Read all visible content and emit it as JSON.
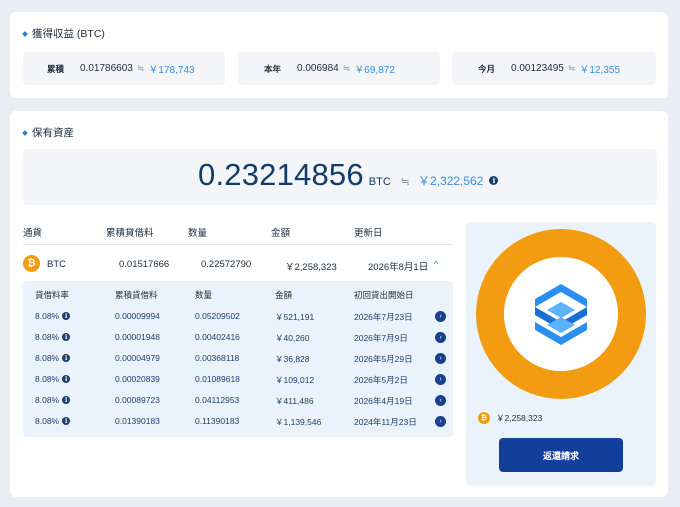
{
  "earnings": {
    "title": "獲得収益 (BTC)",
    "items": [
      {
        "label": "累積",
        "btc": "0.01786603",
        "approx": "≒",
        "yen": "￥178,743"
      },
      {
        "label": "本年",
        "btc": "0.006984",
        "approx": "≒",
        "yen": "￥69,872"
      },
      {
        "label": "今月",
        "btc": "0.00123495",
        "approx": "≒",
        "yen": "￥12,355"
      }
    ]
  },
  "holdings": {
    "title": "保有資産",
    "balance": "0.23214856",
    "unit": "BTC",
    "approx": "≒",
    "yen": "￥2,322,562",
    "headers": [
      "通貨",
      "累積貸借料",
      "数量",
      "金額",
      "更新日"
    ],
    "btc_row": {
      "icon": "bitcoin-icon",
      "currency": "BTC",
      "fee": "0.01517666",
      "qty": "0.22572790",
      "amount": "￥2,258,323",
      "date": "2026年8月1日"
    },
    "sub_headers": [
      "貸借料率",
      "累積貸借料",
      "数量",
      "金額",
      "初回貸出開始日"
    ],
    "sub_rows": [
      {
        "rate": "8.08%",
        "fee": "0.00009994",
        "qty": "0.05209502",
        "amount": "￥521,191",
        "date": "2026年7月23日"
      },
      {
        "rate": "8.08%",
        "fee": "0.00001948",
        "qty": "0.00402416",
        "amount": "￥40,260",
        "date": "2026年7月9日"
      },
      {
        "rate": "8.08%",
        "fee": "0.00004979",
        "qty": "0.00368118",
        "amount": "￥36,828",
        "date": "2026年5月29日"
      },
      {
        "rate": "8.08%",
        "fee": "0.00020839",
        "qty": "0.01089618",
        "amount": "￥109,012",
        "date": "2026年5月2日"
      },
      {
        "rate": "8.08%",
        "fee": "0.00089723",
        "qty": "0.04112953",
        "amount": "￥411,486",
        "date": "2026年4月19日"
      },
      {
        "rate": "8.08%",
        "fee": "0.01390183",
        "qty": "0.11390183",
        "amount": "￥1,139,546",
        "date": "2024年11月23日"
      }
    ],
    "donut": {
      "legend_amount": "￥2,258,323",
      "color": "#f39c12",
      "share": 1.0
    },
    "redeem_label": "返還請求"
  },
  "colors": {
    "accent": "#2a84c9",
    "navy": "#123c6a",
    "btc_orange": "#f39c12",
    "button": "#123f9a"
  }
}
